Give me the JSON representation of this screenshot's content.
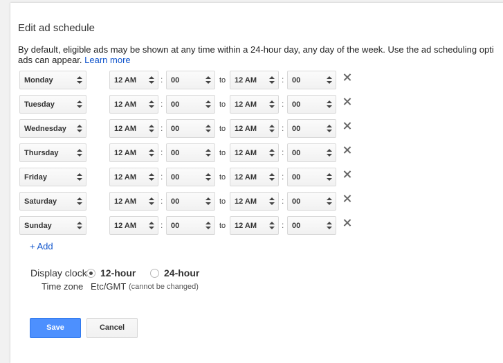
{
  "dialog": {
    "title": "Edit ad schedule",
    "description": "By default, eligible ads may be shown at any time within a 24-hour day, any day of the week. Use the ad scheduling opti",
    "description_line2": "ads can appear.",
    "learn_more": "Learn more"
  },
  "schedule": {
    "to_label": "to",
    "colon": ":",
    "rows": [
      {
        "day": "Monday",
        "start_hour": "12 AM",
        "start_min": "00",
        "end_hour": "12 AM",
        "end_min": "00"
      },
      {
        "day": "Tuesday",
        "start_hour": "12 AM",
        "start_min": "00",
        "end_hour": "12 AM",
        "end_min": "00"
      },
      {
        "day": "Wednesday",
        "start_hour": "12 AM",
        "start_min": "00",
        "end_hour": "12 AM",
        "end_min": "00"
      },
      {
        "day": "Thursday",
        "start_hour": "12 AM",
        "start_min": "00",
        "end_hour": "12 AM",
        "end_min": "00"
      },
      {
        "day": "Friday",
        "start_hour": "12 AM",
        "start_min": "00",
        "end_hour": "12 AM",
        "end_min": "00"
      },
      {
        "day": "Saturday",
        "start_hour": "12 AM",
        "start_min": "00",
        "end_hour": "12 AM",
        "end_min": "00"
      },
      {
        "day": "Sunday",
        "start_hour": "12 AM",
        "start_min": "00",
        "end_hour": "12 AM",
        "end_min": "00"
      }
    ],
    "add_label": "+ Add"
  },
  "clock": {
    "label": "Display clock",
    "option_12": "12-hour",
    "option_24": "24-hour",
    "selected": "12-hour"
  },
  "timezone": {
    "label": "Time zone",
    "value": "Etc/GMT",
    "note": "(cannot be changed)"
  },
  "actions": {
    "save_label": "Save",
    "cancel_label": "Cancel"
  },
  "colors": {
    "primary": "#4d90fe",
    "link": "#1155cc"
  },
  "icons": {
    "remove_row": "close-icon",
    "select_arrows": "updown-arrows-icon"
  }
}
